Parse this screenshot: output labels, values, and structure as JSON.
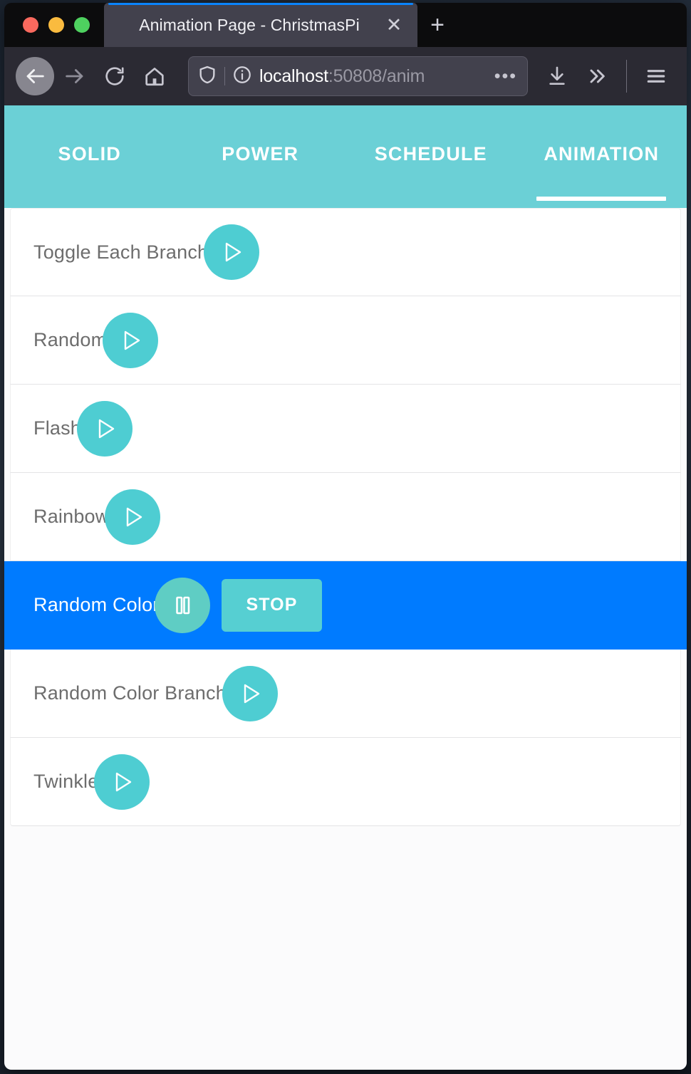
{
  "window": {
    "traffic_lights": [
      "close",
      "minimize",
      "maximize"
    ],
    "colors": {
      "accent_teal": "#6bd0d6",
      "button_teal": "#4ecdd2",
      "active_blue": "#007bff",
      "tab_highlight": "#0a84ff"
    }
  },
  "browser": {
    "tab": {
      "title": "Animation Page - ChristmasPi",
      "close_label": "✕"
    },
    "new_tab_label": "+",
    "toolbar": {
      "back_icon": "back-arrow-icon",
      "forward_icon": "forward-arrow-icon",
      "reload_icon": "reload-icon",
      "home_icon": "home-icon",
      "shield_icon": "shield-icon",
      "info_icon": "info-icon",
      "page_actions_label": "•••",
      "downloads_icon": "download-icon",
      "overflow_label": "»",
      "menu_icon": "hamburger-menu-icon"
    },
    "url": {
      "host": "localhost",
      "path": ":50808/anim",
      "full": "localhost:50808/anim"
    }
  },
  "app": {
    "tabs": [
      {
        "label": "SOLID",
        "active": false
      },
      {
        "label": "POWER",
        "active": false
      },
      {
        "label": "SCHEDULE",
        "active": false
      },
      {
        "label": "ANIMATION",
        "active": true
      }
    ],
    "animations": [
      {
        "name": "Toggle Each Branch",
        "state": "stopped",
        "control": "play"
      },
      {
        "name": "Random",
        "state": "stopped",
        "control": "play"
      },
      {
        "name": "Flash",
        "state": "stopped",
        "control": "play"
      },
      {
        "name": "Rainbow",
        "state": "stopped",
        "control": "play"
      },
      {
        "name": "Random Color",
        "state": "running",
        "control": "pause",
        "stop_label": "STOP"
      },
      {
        "name": "Random Color Branch",
        "state": "stopped",
        "control": "play"
      },
      {
        "name": "Twinkle",
        "state": "stopped",
        "control": "play"
      }
    ]
  }
}
